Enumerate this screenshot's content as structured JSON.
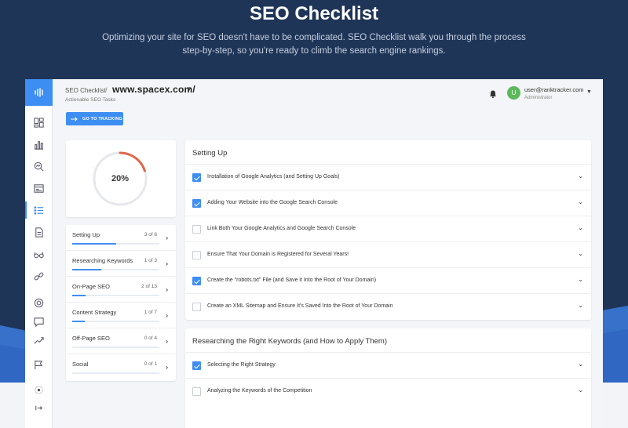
{
  "hero": {
    "title": "SEO Checklist",
    "subtitle": "Optimizing your site for SEO doesn't have to be complicated. SEO Checklist walk you through the process step-by-step, so you're ready to climb the search engine rankings."
  },
  "header": {
    "app_name": "SEO Checklist",
    "separator": "/",
    "site": "www.spacex.com/",
    "subtitle": "Actionable SEO Tasks",
    "user_email": "user@ranktracker.com",
    "user_role": "Administrator",
    "avatar_letter": "U"
  },
  "go_button": {
    "label": "GO TO TRACKING"
  },
  "progress": {
    "label": "20%",
    "value": 0.2
  },
  "categories": [
    {
      "name": "Setting Up",
      "count": "3 of 6",
      "fraction": 0.5
    },
    {
      "name": "Researching Keywords",
      "count": "1 of 3",
      "fraction": 0.33
    },
    {
      "name": "On-Page SEO",
      "count": "2 of 13",
      "fraction": 0.15
    },
    {
      "name": "Content Strategy",
      "count": "1 of 7",
      "fraction": 0.14
    },
    {
      "name": "Off-Page SEO",
      "count": "0 of 4",
      "fraction": 0
    },
    {
      "name": "Social",
      "count": "0 of 1",
      "fraction": 0
    }
  ],
  "sections": [
    {
      "title": "Setting Up",
      "tasks": [
        {
          "text": "Installation of Google Analytics (and Setting Up Goals)",
          "checked": true
        },
        {
          "text": "Adding Your Website into the Google Search Console",
          "checked": true
        },
        {
          "text": "Link Both Your Google Analytics and Google Search Console",
          "checked": false
        },
        {
          "text": "Ensure That Your Domain is Registered for Several Years!",
          "checked": false
        },
        {
          "text": "Create the \"robots.txt\" File (and Save it Into the Root of Your Domain)",
          "checked": true
        },
        {
          "text": "Create an XML Sitemap and Ensure It's Saved Into the Root of Your Domain",
          "checked": false
        }
      ]
    },
    {
      "title": "Researching the Right Keywords (and How to Apply Them)",
      "tasks": [
        {
          "text": "Selecting the Right Strategy",
          "checked": true
        },
        {
          "text": "Analyzing the Keywords of the Competition",
          "checked": false
        }
      ]
    }
  ],
  "colors": {
    "accent": "#3d8ef2",
    "progress_arc": "#e0684a",
    "hero_bg": "#1f3558",
    "avatar": "#5cb85c"
  },
  "icons": {
    "logo": "waveform-icon",
    "nav": [
      "dashboard-icon",
      "bar-chart-icon",
      "search-analysis-icon",
      "report-icon",
      "checklist-icon",
      "document-icon",
      "glasses-icon",
      "link-icon",
      "support-icon",
      "chat-icon",
      "trend-icon",
      "flag-icon",
      "theme-toggle-icon",
      "logout-icon"
    ]
  }
}
